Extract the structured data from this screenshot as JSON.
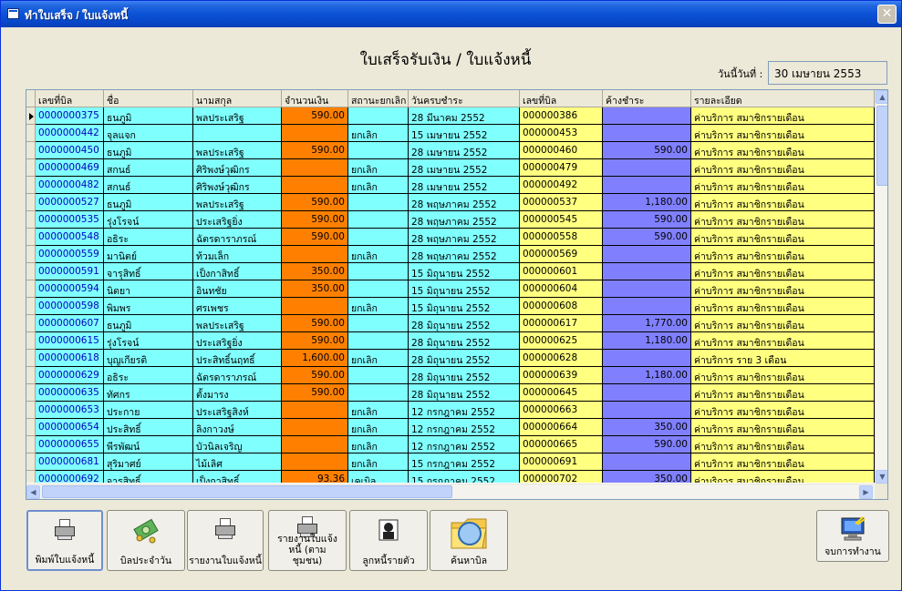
{
  "window": {
    "title": "ทำใบเสร็จ / ใบแจ้งหนี้",
    "close_symbol": "✕"
  },
  "page": {
    "title": "ใบเสร็จรับเงิน / ใบแจ้งหนี้",
    "date_label": "วันนี้วันที่ :",
    "date_value": "30 เมษายน 2553"
  },
  "grid": {
    "columns": [
      "เลขที่บิล",
      "ชื่อ",
      "นามสกุล",
      "จำนวนเงิน",
      "สถานะยกเลิก",
      "วันครบชำระ",
      "เลขที่บิล",
      "ค้างชำระ",
      "รายละเอียด"
    ],
    "rows": [
      [
        "0000000375",
        "ธนภูมิ",
        "พลประเสริฐ",
        "590.00",
        "",
        "28 มีนาคม 2552",
        "000000386",
        "",
        "ค่าบริการ สมาชิกรายเดือน"
      ],
      [
        "0000000442",
        "จุลแจก",
        "",
        "",
        "ยกเลิก",
        "15 เมษายน 2552",
        "000000453",
        "",
        "ค่าบริการ สมาชิกรายเดือน"
      ],
      [
        "0000000450",
        "ธนภูมิ",
        "พลประเสริฐ",
        "590.00",
        "",
        "28 เมษายน 2552",
        "000000460",
        "590.00",
        "ค่าบริการ สมาชิกรายเดือน"
      ],
      [
        "0000000469",
        "สกนธ์",
        "ศิริพงษ์วุฒิกร",
        "",
        "ยกเลิก",
        "28 เมษายน 2552",
        "000000479",
        "",
        "ค่าบริการ สมาชิกรายเดือน"
      ],
      [
        "0000000482",
        "สกนธ์",
        "ศิริพงษ์วุฒิกร",
        "",
        "ยกเลิก",
        "28 เมษายน 2552",
        "000000492",
        "",
        "ค่าบริการ สมาชิกรายเดือน"
      ],
      [
        "0000000527",
        "ธนภูมิ",
        "พลประเสริฐ",
        "590.00",
        "",
        "28 พฤษภาคม 2552",
        "000000537",
        "1,180.00",
        "ค่าบริการ สมาชิกรายเดือน"
      ],
      [
        "0000000535",
        "รุ่งโรจน์",
        "ประเสริฐยิ่ง",
        "590.00",
        "",
        "28 พฤษภาคม 2552",
        "000000545",
        "590.00",
        "ค่าบริการ สมาชิกรายเดือน"
      ],
      [
        "0000000548",
        "อธิระ",
        "ฉัตรดาราภรณ์",
        "590.00",
        "",
        "28 พฤษภาคม 2552",
        "000000558",
        "590.00",
        "ค่าบริการ สมาชิกรายเดือน"
      ],
      [
        "0000000559",
        "มานิตย์",
        "ท้วมเล็ก",
        "",
        "ยกเลิก",
        "28 พฤษภาคม 2552",
        "000000569",
        "",
        "ค่าบริการ สมาชิกรายเดือน"
      ],
      [
        "0000000591",
        "จารุสิทธิ์",
        "เป็งกาสิทธิ์",
        "350.00",
        "",
        "15 มิถุนายน 2552",
        "000000601",
        "",
        "ค่าบริการ สมาชิกรายเดือน"
      ],
      [
        "0000000594",
        "นิตยา",
        "อินทชัย",
        "350.00",
        "",
        "15 มิถุนายน 2552",
        "000000604",
        "",
        "ค่าบริการ สมาชิกรายเดือน"
      ],
      [
        "0000000598",
        "พิมพร",
        "ศรเพชร",
        "",
        "ยกเลิก",
        "15 มิถุนายน 2552",
        "000000608",
        "",
        "ค่าบริการ สมาชิกรายเดือน"
      ],
      [
        "0000000607",
        "ธนภูมิ",
        "พลประเสริฐ",
        "590.00",
        "",
        "28 มิถุนายน 2552",
        "000000617",
        "1,770.00",
        "ค่าบริการ สมาชิกรายเดือน"
      ],
      [
        "0000000615",
        "รุ่งโรจน์",
        "ประเสริฐยิ่ง",
        "590.00",
        "",
        "28 มิถุนายน 2552",
        "000000625",
        "1,180.00",
        "ค่าบริการ สมาชิกรายเดือน"
      ],
      [
        "0000000618",
        "บุญเกียรติ",
        "ประสิทธิ์นฤทธิ์",
        "1,600.00",
        "ยกเลิก",
        "28 มิถุนายน 2552",
        "000000628",
        "",
        "ค่าบริการ ราย 3 เดือน"
      ],
      [
        "0000000629",
        "อธิระ",
        "ฉัตรดาราภรณ์",
        "590.00",
        "",
        "28 มิถุนายน 2552",
        "000000639",
        "1,180.00",
        "ค่าบริการ สมาชิกรายเดือน"
      ],
      [
        "0000000635",
        "ทัศกร",
        "ตั้งมารง",
        "590.00",
        "",
        "28 มิถุนายน 2552",
        "000000645",
        "",
        "ค่าบริการ สมาชิกรายเดือน"
      ],
      [
        "0000000653",
        "ประกาย",
        "ประเสริฐสิงห์",
        "",
        "ยกเลิก",
        "12 กรกฎาคม 2552",
        "000000663",
        "",
        "ค่าบริการ สมาชิกรายเดือน"
      ],
      [
        "0000000654",
        "ประสิทธิ์",
        "ลิงกาวงษ์",
        "",
        "ยกเลิก",
        "12 กรกฎาคม 2552",
        "000000664",
        "350.00",
        "ค่าบริการ สมาชิกรายเดือน"
      ],
      [
        "0000000655",
        "พีรพัฒน์",
        "บัวนิลเจริญ",
        "",
        "ยกเลิก",
        "12 กรกฎาคม 2552",
        "000000665",
        "590.00",
        "ค่าบริการ สมาชิกรายเดือน"
      ],
      [
        "0000000681",
        "สุริมาศย์",
        "ไม้เลิศ",
        "",
        "ยกเลิก",
        "15 กรกฎาคม 2552",
        "000000691",
        "",
        "ค่าบริการ สมาชิกรายเดือน"
      ],
      [
        "0000000692",
        "จารุสิทธิ์",
        "เป็งกาสิทธิ์",
        "93.36",
        "เคเบิล",
        "15 กรกฎาคม 2552",
        "000000702",
        "350.00",
        "ค่าบริการ สมาชิกรายเดือน"
      ]
    ]
  },
  "scrollbar": {
    "up": "▲",
    "down": "▼",
    "left": "◀",
    "right": "▶"
  },
  "toolbar": {
    "print_invoice": "พิมพ์ใบแจ้งหนี้",
    "daily_bill": "บิลประจำวัน",
    "invoice_report": "รายงานใบแจ้งหนี้",
    "invoice_report_community": "รายงานใบแจ้งหนี้ (ตามชุมชน)",
    "debtor_individual": "ลูกหนี้รายตัว",
    "search_bill": "ค้นหาบิล",
    "end_work": "จบการทำงาน"
  },
  "colors": {
    "cyan": "#80ffff",
    "orange": "#ff8000",
    "yellow": "#ffff80",
    "purple": "#8080ff",
    "bill_no_text": "#0000c0"
  }
}
